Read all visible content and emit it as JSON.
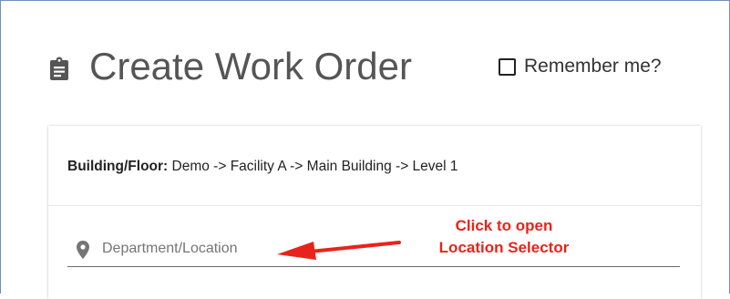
{
  "header": {
    "title": "Create Work Order",
    "title_icon": "clipboard-icon",
    "remember_label": "Remember me?",
    "remember_checked": false
  },
  "building": {
    "label": "Building/Floor:",
    "value": "Demo -> Facility A -> Main Building -> Level 1"
  },
  "location": {
    "placeholder": "Department/Location",
    "icon": "map-pin-icon"
  },
  "annotation": {
    "line1": "Click to open",
    "line2": "Location Selector",
    "color": "#e8231c"
  },
  "colors": {
    "frame_border": "#6f8fb8",
    "title_text": "#555555",
    "placeholder_text": "#757575"
  }
}
